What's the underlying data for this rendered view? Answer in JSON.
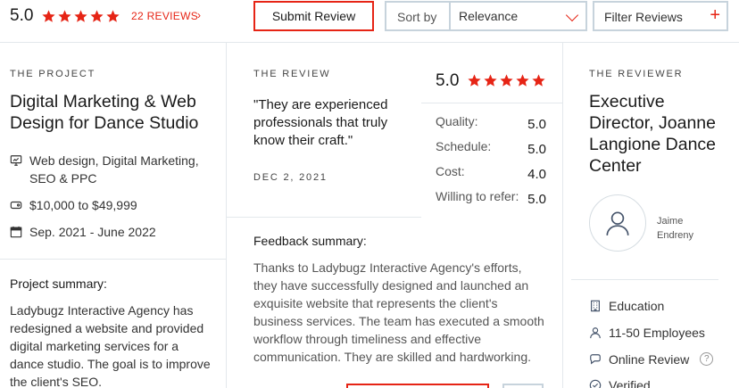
{
  "topbar": {
    "rating": "5.0",
    "reviews_link": "22 REVIEWS",
    "chevron": "›",
    "submit_label": "Submit Review",
    "sort_label": "Sort by",
    "sort_value": "Relevance",
    "filter_label": "Filter Reviews",
    "filter_plus": "+"
  },
  "project": {
    "heading": "THE PROJECT",
    "title": "Digital Marketing & Web Design for Dance Studio",
    "services_icon": "monitor-icon",
    "services": "Web design, Digital Marketing, SEO & PPC",
    "budget_icon": "tag-icon",
    "budget": "$10,000 to $49,999",
    "dates_icon": "calendar-icon",
    "dates": "Sep. 2021 - June 2022",
    "summary_heading": "Project summary:",
    "summary": "Ladybugz Interactive Agency has redesigned a website and provided digital marketing services for a dance studio. The goal is to improve the client's SEO."
  },
  "review": {
    "heading": "THE REVIEW",
    "quote": "\"They are experienced professionals that truly know their craft.\"",
    "date": "DEC 2, 2021",
    "overall": "5.0",
    "scores": [
      {
        "label": "Quality:",
        "value": "5.0"
      },
      {
        "label": "Schedule:",
        "value": "5.0"
      },
      {
        "label": "Cost:",
        "value": "4.0"
      },
      {
        "label": "Willing to refer:",
        "value": "5.0"
      }
    ],
    "feedback_heading": "Feedback summary:",
    "feedback": "Thanks to Ladybugz Interactive Agency's efforts, they have successfully designed and launched an exquisite website that represents the client's business services. The team has executed a smooth workflow through timeliness and effective communication. They are skilled and hardworking."
  },
  "reviewer": {
    "heading": "THE REVIEWER",
    "title": "Executive Director, Joanne Langione Dance Center",
    "avatar_icon": "user-icon",
    "name": "Jaime Endreny",
    "industry_icon": "building-icon",
    "industry": "Education",
    "employees_icon": "person-icon",
    "employees": "11-50 Employees",
    "review_type_icon": "chat-icon",
    "review_type": "Online Review",
    "help_mark": "?",
    "verified_icon": "check-icon",
    "verified": "Verified"
  },
  "colors": {
    "accent": "#e62415",
    "border": "#c7d3dc",
    "divider": "#e3e8ec"
  }
}
